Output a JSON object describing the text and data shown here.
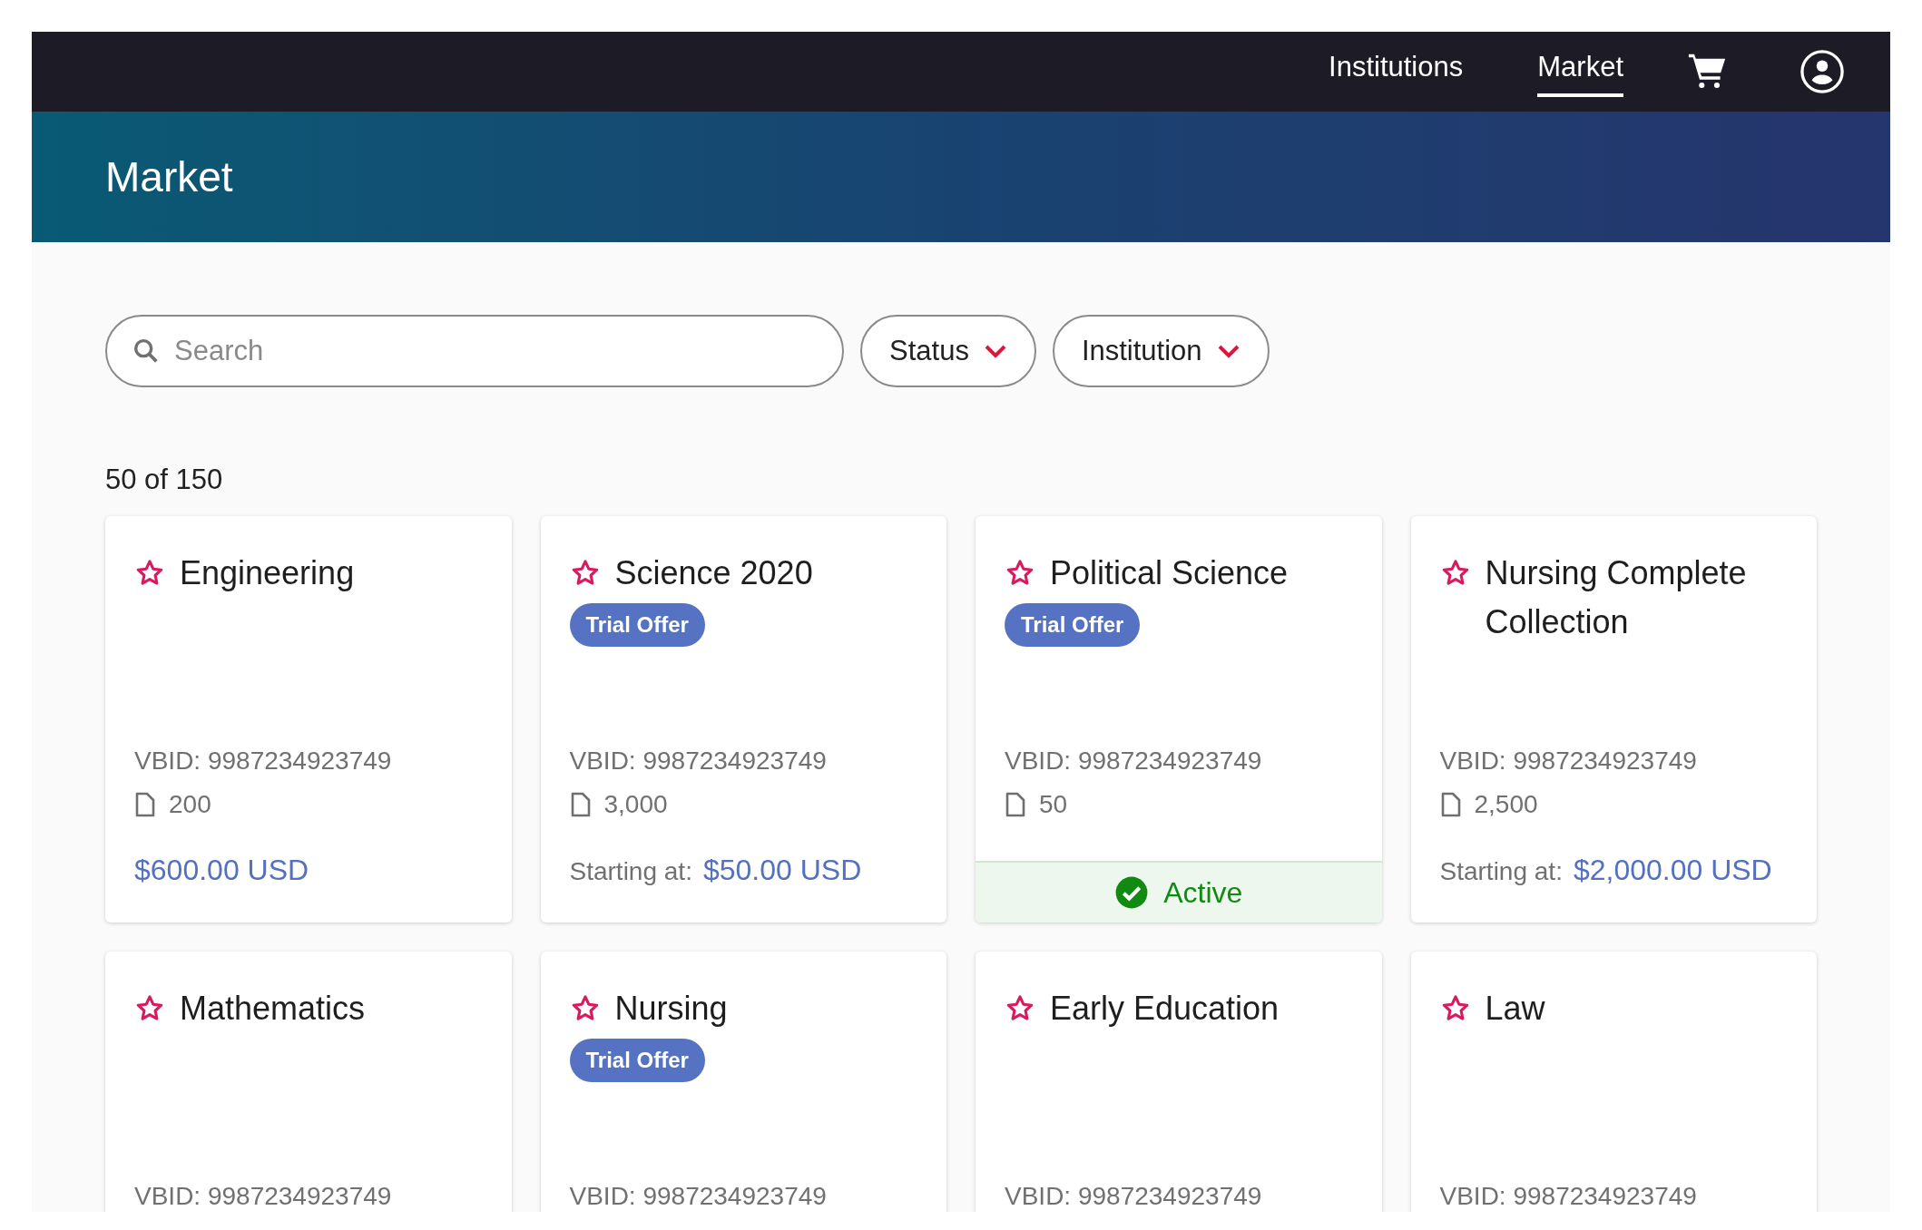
{
  "nav": {
    "items": [
      {
        "label": "Institutions",
        "selected": false
      },
      {
        "label": "Market",
        "selected": true
      }
    ]
  },
  "header": {
    "title": "Market"
  },
  "filters": {
    "search": {
      "placeholder": "Search"
    },
    "dropdowns": [
      "Status",
      "Institution"
    ]
  },
  "result_count": "50 of 150",
  "cards": [
    {
      "title": "Engineering",
      "favorited": false,
      "vbid": "VBID: 9987234923749",
      "pages": "200",
      "price": "$600.00 USD"
    },
    {
      "title": "Science 2020",
      "favorited": false,
      "badge": "Trial Offer",
      "vbid": "VBID: 9987234923749",
      "pages": "3,000",
      "price_label": "Starting at:",
      "price": "$50.00 USD"
    },
    {
      "title": "Political Science",
      "favorited": false,
      "badge": "Trial Offer",
      "vbid": "VBID: 9987234923749",
      "pages": "50",
      "status": "Active"
    },
    {
      "title": "Nursing Complete Collection",
      "favorited": false,
      "vbid": "VBID: 9987234923749",
      "pages": "2,500",
      "price_label": "Starting at:",
      "price": "$2,000.00 USD"
    },
    {
      "title": "Mathematics",
      "favorited": false,
      "vbid": "VBID: 9987234923749"
    },
    {
      "title": "Nursing",
      "favorited": false,
      "badge": "Trial Offer",
      "vbid": "VBID: 9987234923749"
    },
    {
      "title": "Early Education",
      "favorited": false,
      "vbid": "VBID: 9987234923749"
    },
    {
      "title": "Law",
      "favorited": false,
      "vbid": "VBID: 9987234923749"
    }
  ]
}
